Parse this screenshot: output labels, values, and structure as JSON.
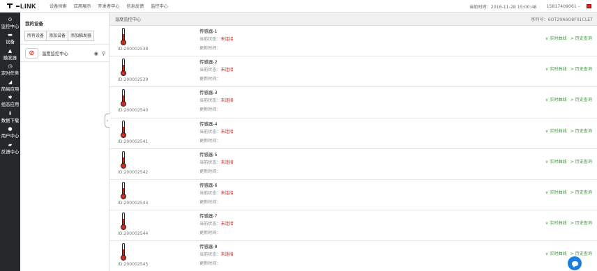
{
  "app": {
    "logo_text": "LINK",
    "nav": [
      "设备探索",
      "应用展示",
      "开发者中心",
      "信息反馈",
      "监控中心"
    ],
    "current_time": "当前时间：2016-11-28 15:00:48",
    "user": "15817409061 -"
  },
  "sidebar": {
    "items": [
      {
        "label": "监控中心",
        "icon": "monitor-icon"
      },
      {
        "label": "设备",
        "icon": "device-icon"
      },
      {
        "label": "触发器",
        "icon": "trigger-icon"
      },
      {
        "label": "定时任务",
        "icon": "clock-icon"
      },
      {
        "label": "简易应用",
        "icon": "app-icon"
      },
      {
        "label": "组态应用",
        "icon": "config-icon"
      },
      {
        "label": "数据下载",
        "icon": "download-icon"
      },
      {
        "label": "用户中心",
        "icon": "user-icon"
      },
      {
        "label": "反馈中心",
        "icon": "feedback-icon"
      }
    ]
  },
  "devices": {
    "title": "我的设备",
    "buttons": [
      "所有设备",
      "添加设备",
      "添加触发器"
    ],
    "selected": "温度监控中心"
  },
  "main": {
    "title": "温度监控中心",
    "serial": "序列号：6OT29A6G8F01CLET",
    "status_label": "当前状态：",
    "updated_label": "更新时间：",
    "realtime_label": "∨ 实时曲线",
    "history_label": "> 历史查询",
    "sensors": [
      {
        "name": "传感器-1",
        "id": "ID:200002538",
        "status": "未连接"
      },
      {
        "name": "传感器-2",
        "id": "ID:200002539",
        "status": "未连接"
      },
      {
        "name": "传感器-3",
        "id": "ID:200002540",
        "status": "未连接"
      },
      {
        "name": "传感器-4",
        "id": "ID:200002541",
        "status": "未连接"
      },
      {
        "name": "传感器-5",
        "id": "ID:200002542",
        "status": "未连接"
      },
      {
        "name": "传感器-6",
        "id": "ID:200002543",
        "status": "未连接"
      },
      {
        "name": "传感器-7",
        "id": "ID:200002544",
        "status": "未连接"
      },
      {
        "name": "传感器-8",
        "id": "ID:200002545",
        "status": "未连接"
      }
    ]
  }
}
